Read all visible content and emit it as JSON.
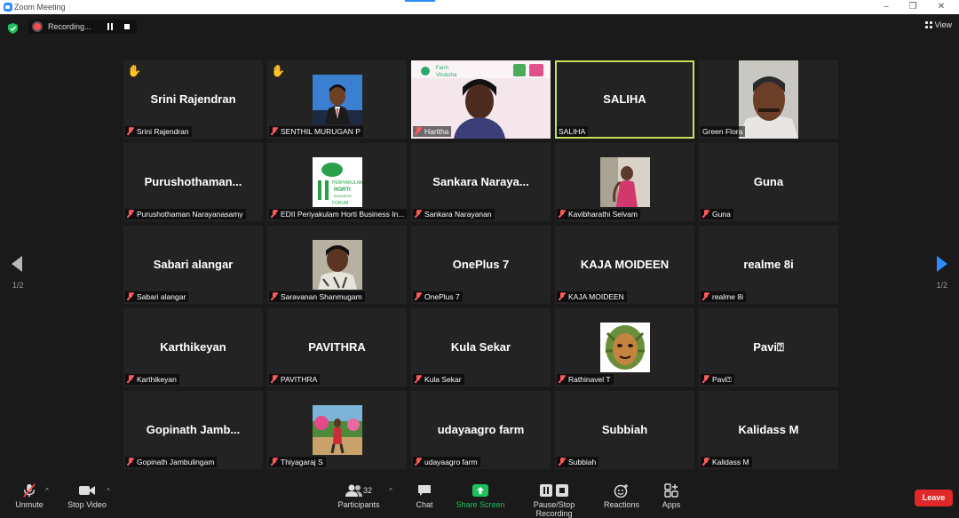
{
  "window": {
    "title": "Zoom Meeting"
  },
  "recording": {
    "label": "Recording..."
  },
  "view": {
    "label": "View"
  },
  "pagination": {
    "left": "1/2",
    "right": "1/2"
  },
  "tiles": [
    {
      "big": "Srini Rajendran",
      "label": "Srini Rajendran"
    },
    {
      "big": "",
      "label": "SENTHIL MURUGAN P"
    },
    {
      "big": "",
      "label": "Haritha",
      "logo_text": "Farm Viruksha"
    },
    {
      "big": "SALIHA",
      "label": "SALIHA"
    },
    {
      "big": "",
      "label": "Green Flora"
    },
    {
      "big": "Purushothaman...",
      "label": "Purushothaman Narayanasamy"
    },
    {
      "big": "",
      "label": "EDII Periyakulam Horti Business In...",
      "logo_text": "EDII PERIYAKULAM HORTI BUSINESS INCUBATION FORUM"
    },
    {
      "big": "Sankara  Naraya...",
      "label": "Sankara Narayanan"
    },
    {
      "big": "",
      "label": "Kavibharathi Selvam"
    },
    {
      "big": "Guna",
      "label": "Guna"
    },
    {
      "big": "Sabari alangar",
      "label": "Sabari alangar"
    },
    {
      "big": "",
      "label": "Saravanan Shanmugam"
    },
    {
      "big": "OnePlus 7",
      "label": "OnePlus 7"
    },
    {
      "big": "KAJA MOIDEEN",
      "label": "KAJA MOIDEEN"
    },
    {
      "big": "realme 8i",
      "label": "realme 8i"
    },
    {
      "big": "Karthikeyan",
      "label": "Karthikeyan"
    },
    {
      "big": "PAVITHRA",
      "label": "PAVITHRA"
    },
    {
      "big": "Kula Sekar",
      "label": "Kula Sekar"
    },
    {
      "big": "",
      "label": "Rathinavel T"
    },
    {
      "big": "Pavi⍰",
      "label": "Pavi⍰"
    },
    {
      "big": "Gopinath  Jamb...",
      "label": "Gopinath Jambulingam"
    },
    {
      "big": "",
      "label": "Thiyagaraj S"
    },
    {
      "big": "udayaagro farm",
      "label": "udayaagro farm"
    },
    {
      "big": "Subbiah",
      "label": "Subbiah"
    },
    {
      "big": "Kalidass M",
      "label": "Kalidass M"
    }
  ],
  "toolbar": {
    "unmute": "Unmute",
    "stop_video": "Stop Video",
    "participants": "Participants",
    "participants_count": "32",
    "chat": "Chat",
    "share_screen": "Share Screen",
    "pause_recording": "Pause/Stop Recording",
    "reactions": "Reactions",
    "apps": "Apps",
    "leave": "Leave"
  },
  "colors": {
    "accent": "#2d8cff",
    "share": "#1fbf5e",
    "leave": "#e02828",
    "active_border": "#c8e05a"
  }
}
